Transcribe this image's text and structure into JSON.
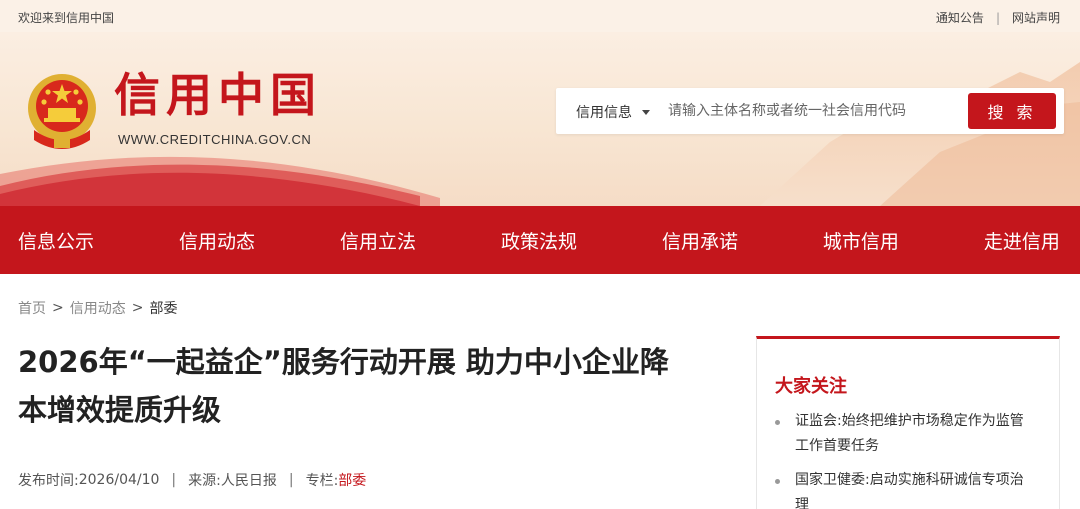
{
  "topbar": {
    "welcome": "欢迎来到信用中国",
    "links": [
      "通知公告",
      "网站声明"
    ]
  },
  "header": {
    "logo_text": "信用中国",
    "logo_url": "WWW.CREDITCHINA.GOV.CN",
    "search": {
      "type_label": "信用信息",
      "placeholder": "请输入主体名称或者统一社会信用代码",
      "button_label": "搜 索"
    }
  },
  "nav": {
    "items": [
      "信息公示",
      "信用动态",
      "信用立法",
      "政策法规",
      "信用承诺",
      "城市信用",
      "走进信用"
    ]
  },
  "breadcrumb": {
    "items": [
      "首页",
      "信用动态"
    ],
    "current": "部委",
    "separator": ">"
  },
  "article": {
    "title_line1": "2026年“一起益企”服务行动开展 助力中小企业降",
    "title_line2": "本增效提质升级",
    "meta": {
      "date_label": "发布时间:",
      "date": "2026/04/10",
      "source_label": "来源:",
      "source": "人民日报",
      "column_label": "专栏:",
      "column": "部委",
      "separator": "|"
    }
  },
  "sidebar": {
    "title": "大家关注",
    "items": [
      {
        "line1": "证监会:始终把维护市场稳定作为监管",
        "line2": "工作首要任务"
      },
      {
        "line1": "国家卫健委:启动实施科研诚信专项治",
        "line2": "理"
      }
    ]
  },
  "colors": {
    "brand_red": "#c4161c",
    "banner_bg": "#f8e6d3"
  }
}
